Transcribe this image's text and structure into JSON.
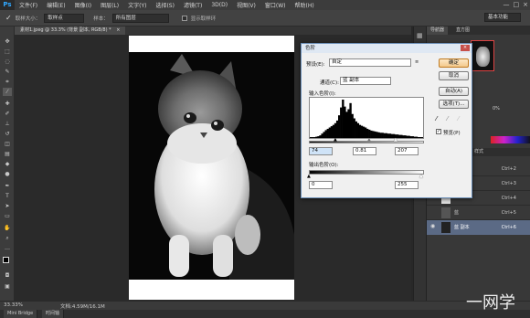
{
  "app": {
    "logo": "Ps"
  },
  "menubar": {
    "items": [
      "文件(F)",
      "编辑(E)",
      "图像(I)",
      "图层(L)",
      "文字(Y)",
      "选择(S)",
      "滤镜(T)",
      "3D(D)",
      "视图(V)",
      "窗口(W)",
      "帮助(H)"
    ],
    "window_controls": [
      "—",
      "□",
      "×"
    ]
  },
  "options_bar": {
    "sample_size_label": "取样大小：",
    "sample_size_value": "取样点",
    "sample_label": "样本：",
    "sample_value": "所有图层",
    "show_ring_label": "显示取样环",
    "workspace_value": "基本功能"
  },
  "document": {
    "tab_title": "素材1.jpeg @ 33.3% (背景 副本, RGB/8) *",
    "zoom": "33.33%",
    "doc_info": "文档:4.59M/16.1M"
  },
  "bottom_tabs": [
    "Mini Bridge",
    "时间轴"
  ],
  "right_panels": {
    "nav_tabs": [
      "导航器",
      "直方图"
    ],
    "layer_tabs": [
      "图层",
      "通道",
      "路径",
      "样式"
    ],
    "opacity_value": "0%",
    "channels": [
      {
        "name": "RGB",
        "shortcut": "Ctrl+2"
      },
      {
        "name": "红",
        "shortcut": "Ctrl+3"
      },
      {
        "name": "绿",
        "shortcut": "Ctrl+4"
      },
      {
        "name": "蓝",
        "shortcut": "Ctrl+5"
      },
      {
        "name": "蓝 副本",
        "shortcut": "Ctrl+6"
      }
    ]
  },
  "levels_dialog": {
    "title": "色阶",
    "preset_label": "预设(E):",
    "preset_value": "自定",
    "channel_label": "通道(C):",
    "channel_value": "蓝 副本",
    "input_label": "输入色阶(I):",
    "input_values": [
      "74",
      "0.81",
      "207"
    ],
    "output_label": "输出色阶(O):",
    "output_values": [
      "0",
      "255"
    ],
    "buttons": [
      "确定",
      "取消",
      "自动(A)",
      "选项(T)..."
    ],
    "preview_label": "预览(P)",
    "preview_checked": true
  },
  "histogram": {
    "note": "",
    "levels": [
      2,
      2,
      2,
      3,
      4,
      6,
      10,
      14,
      18,
      21,
      24,
      27,
      30,
      34,
      40,
      52,
      70,
      88,
      72,
      60,
      66,
      80,
      55,
      45,
      38,
      34,
      30,
      28,
      26,
      24,
      21,
      19,
      17,
      16,
      15,
      14,
      13,
      12,
      12,
      11,
      11,
      10,
      10,
      9,
      9,
      8,
      8,
      7,
      7,
      6,
      6,
      5,
      5,
      4,
      4,
      3,
      3,
      2,
      2,
      2
    ]
  },
  "watermark": "一网学"
}
